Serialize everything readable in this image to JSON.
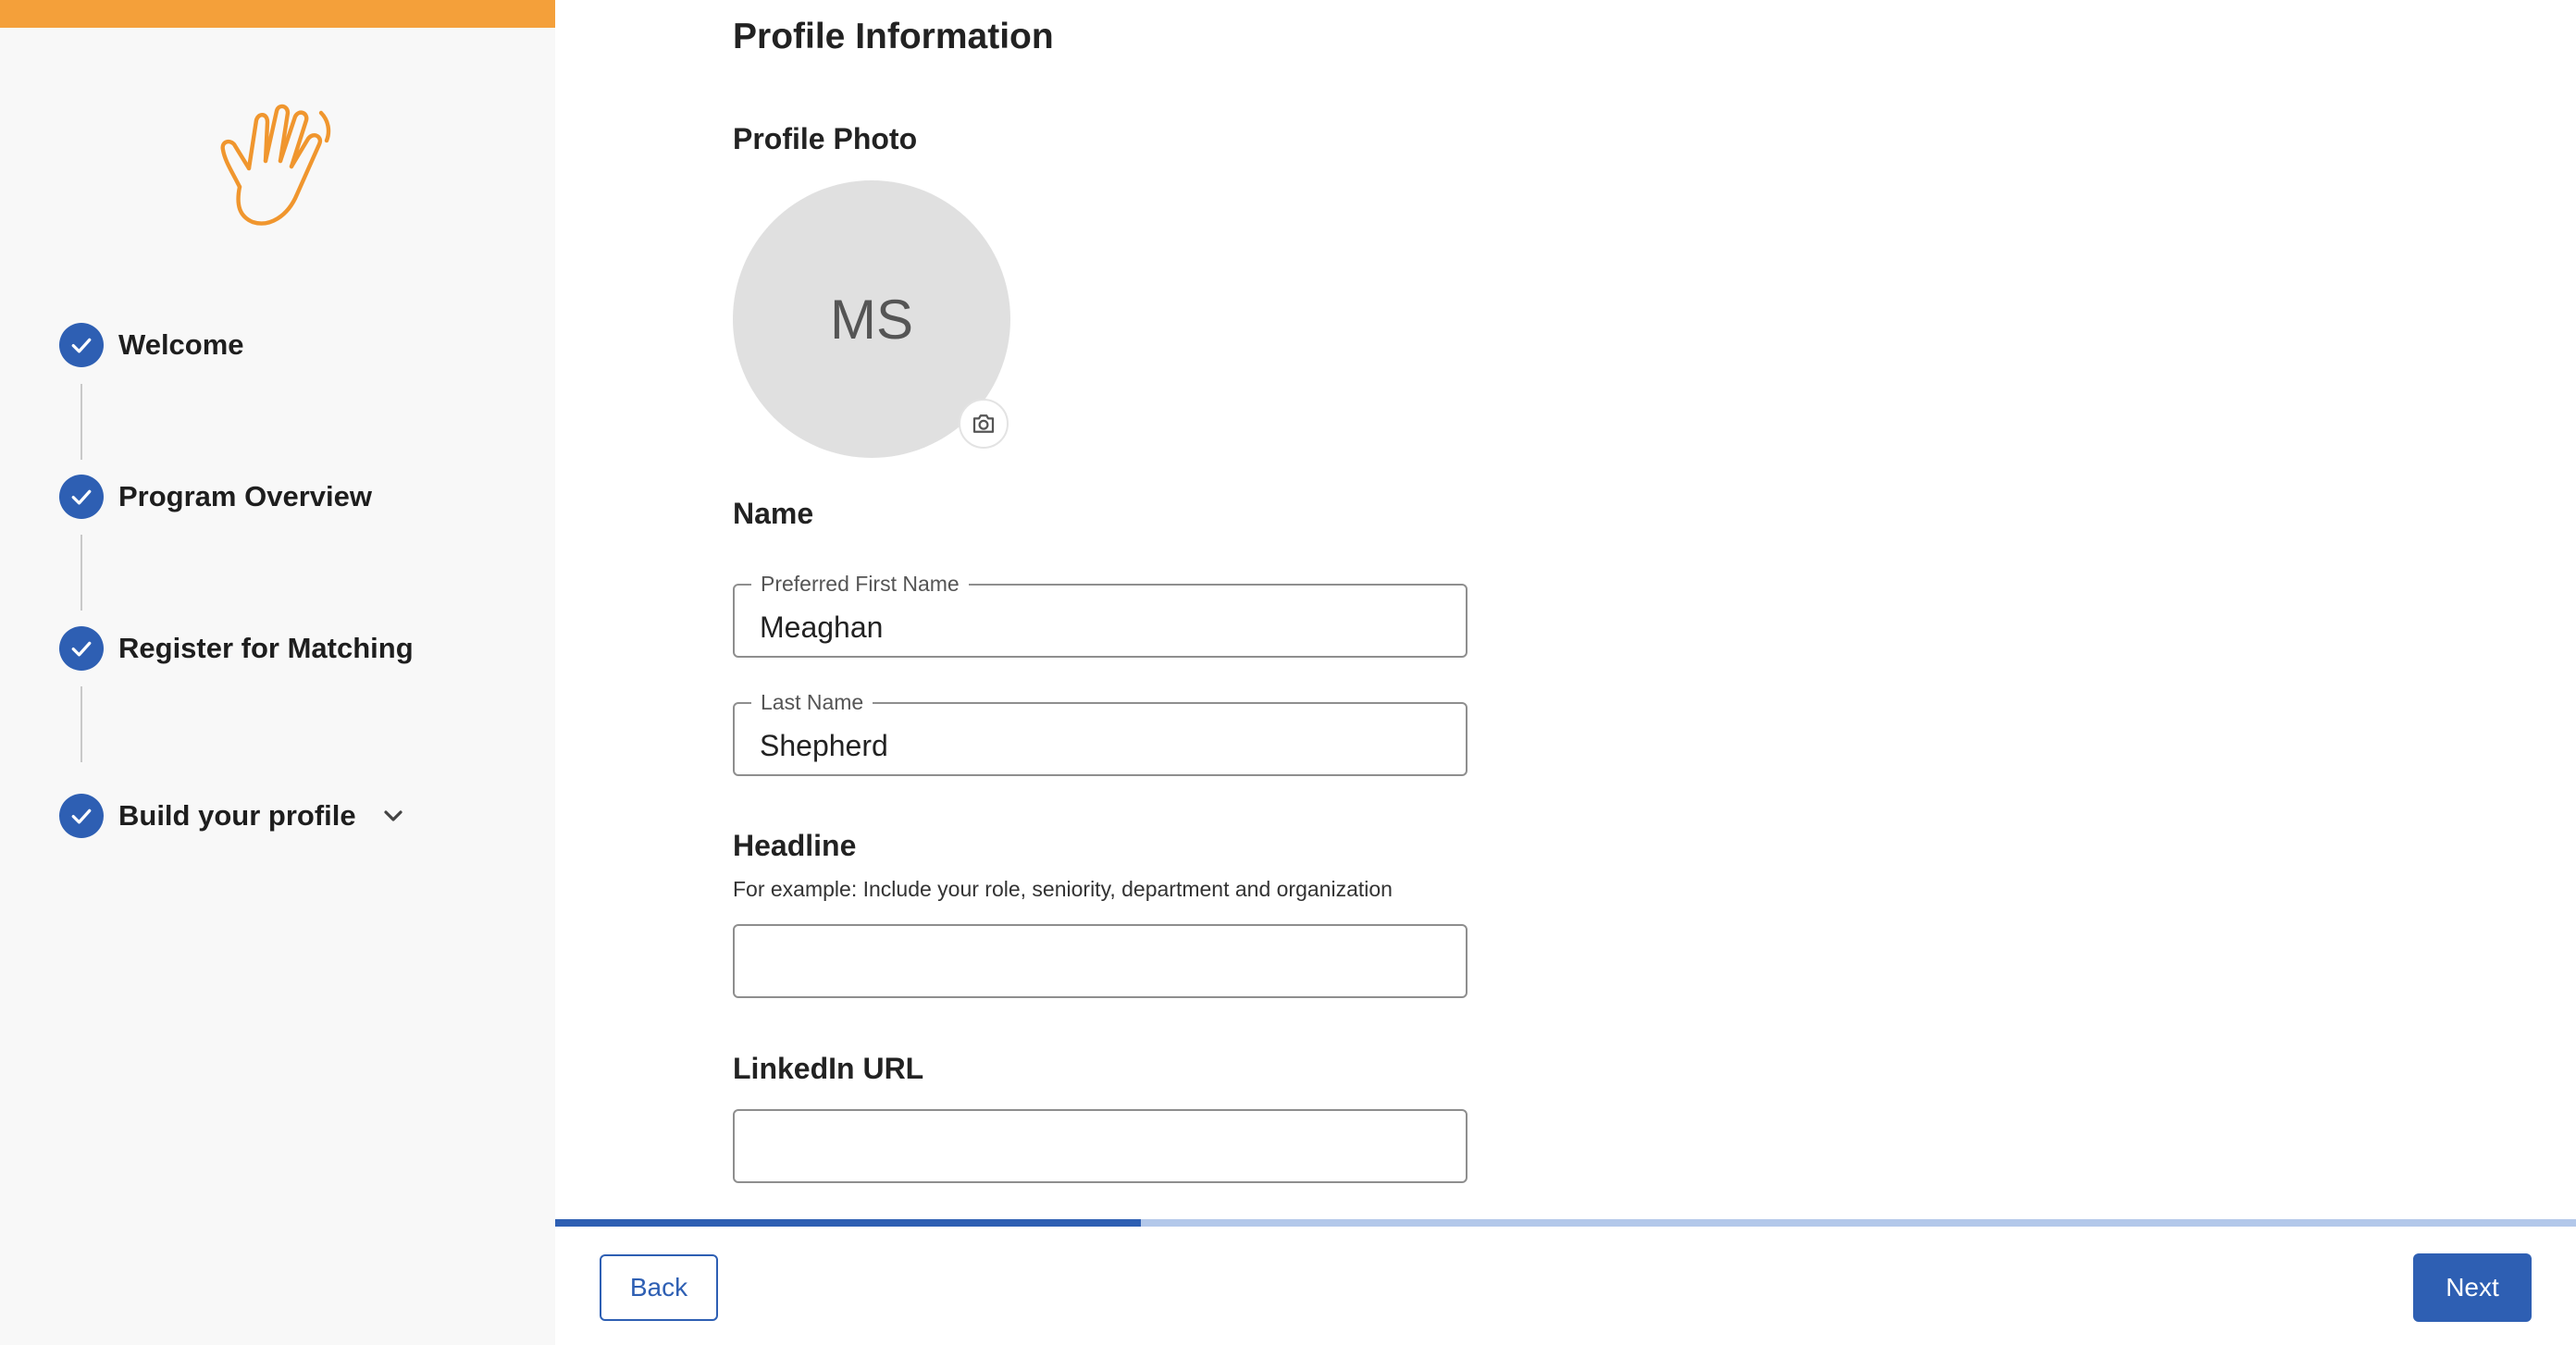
{
  "sidebar": {
    "steps": [
      {
        "label": "Welcome",
        "completed": true
      },
      {
        "label": "Program Overview",
        "completed": true
      },
      {
        "label": "Register for Matching",
        "completed": true
      },
      {
        "label": "Build your profile",
        "completed": true
      }
    ],
    "icons": {
      "hero": "waving-hand-icon",
      "step": "check-icon",
      "expand": "chevron-down-icon"
    }
  },
  "main": {
    "title": "Profile Information",
    "photo": {
      "section_title": "Profile Photo",
      "initials": "MS",
      "upload_icon": "camera-icon"
    },
    "name": {
      "section_title": "Name",
      "first_name": {
        "label": "Preferred First Name",
        "value": "Meaghan"
      },
      "last_name": {
        "label": "Last Name",
        "value": "Shepherd"
      }
    },
    "headline": {
      "section_title": "Headline",
      "helper": "For example: Include your role, seniority, department and organization",
      "value": ""
    },
    "linkedin": {
      "section_title": "LinkedIn URL",
      "value": ""
    }
  },
  "progress": {
    "percent": 29
  },
  "footer": {
    "back_label": "Back",
    "next_label": "Next"
  },
  "colors": {
    "accent": "#2e5fb3",
    "brand_orange": "#f4a03a",
    "progress_track": "#b3c8ea"
  }
}
